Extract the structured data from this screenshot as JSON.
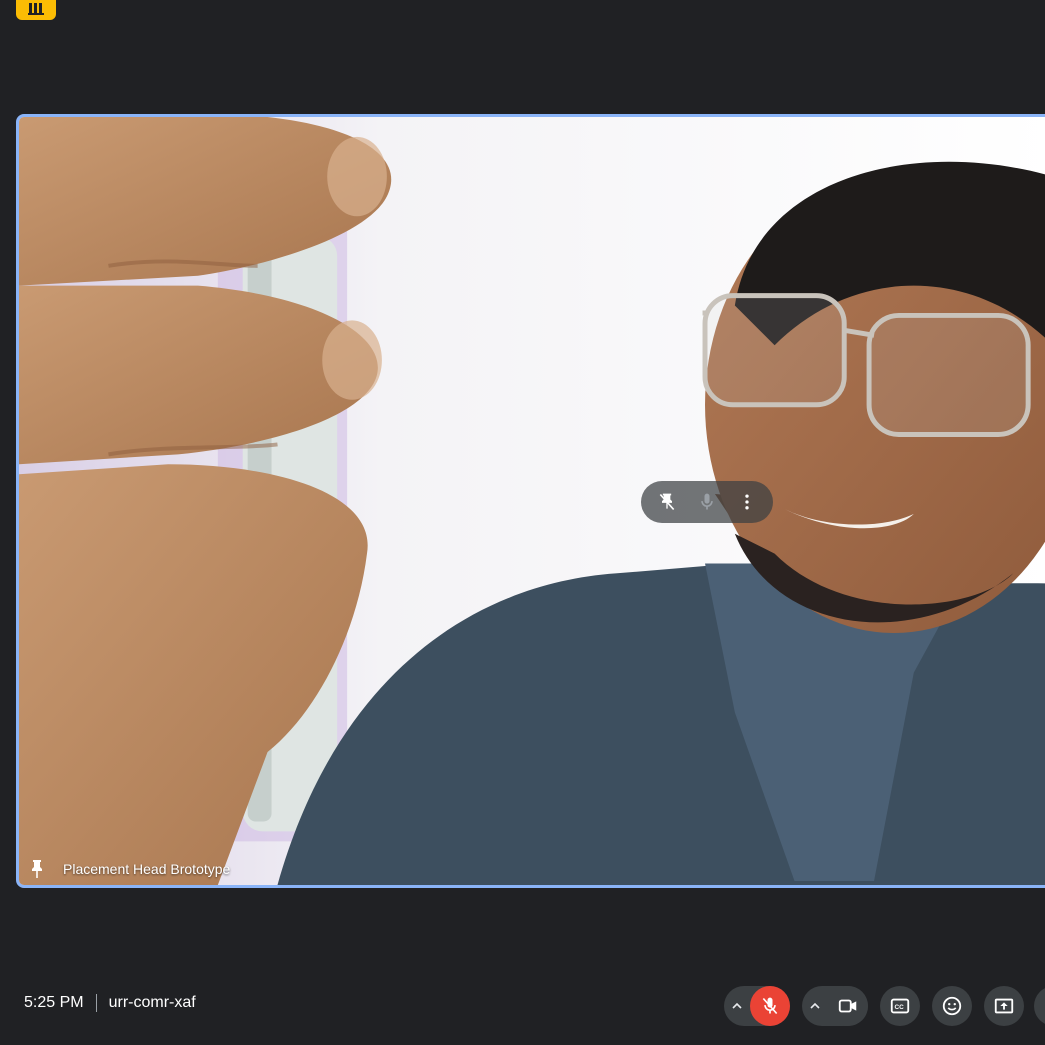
{
  "tile": {
    "participant_name": "Placement Head Brototype"
  },
  "meeting": {
    "time": "5:25 PM",
    "code": "urr-comr-xaf"
  },
  "icons": {
    "pin": "pin-icon",
    "unpin": "unpin-icon",
    "mic": "mic-icon",
    "more": "more-vert-icon",
    "mic_off": "mic-off-icon",
    "camera": "videocam-icon",
    "captions": "closed-caption-icon",
    "emoji": "emoji-icon",
    "present": "present-screen-icon",
    "caret": "chevron-up-icon"
  },
  "colors": {
    "background": "#202124",
    "tile_border": "#8ab4f8",
    "mic_off_button": "#ea4335",
    "button_bg": "#3c4043",
    "badge": "#fbbc04"
  }
}
